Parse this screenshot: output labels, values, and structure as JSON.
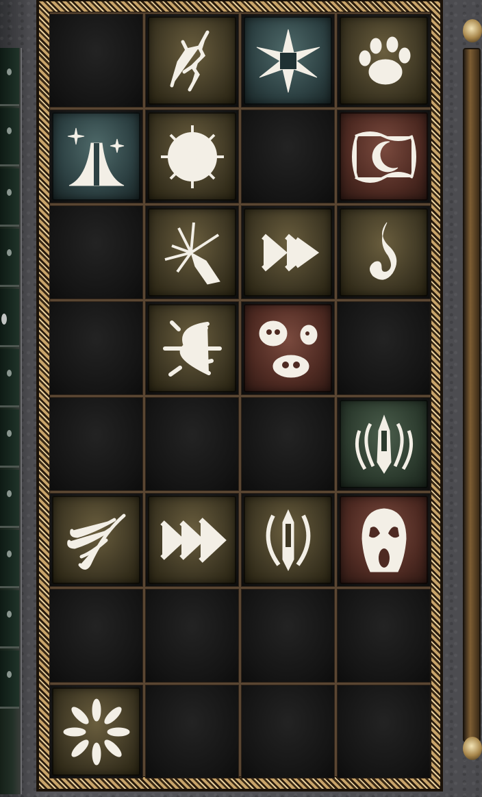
{
  "panel": {
    "columns": 4,
    "rows": 8,
    "slots": [
      {
        "filled": false
      },
      {
        "filled": true,
        "icon": "branch-crack-icon",
        "bg": "olive"
      },
      {
        "filled": true,
        "icon": "star-burst-icon",
        "bg": "teal"
      },
      {
        "filled": true,
        "icon": "paw-print-icon",
        "bg": "olive"
      },
      {
        "filled": true,
        "icon": "sparkle-mountain-icon",
        "bg": "teal"
      },
      {
        "filled": true,
        "icon": "spider-web-icon",
        "bg": "olive"
      },
      {
        "filled": false
      },
      {
        "filled": true,
        "icon": "crescent-moon-icon",
        "bg": "maroon"
      },
      {
        "filled": false
      },
      {
        "filled": true,
        "icon": "shatter-strike-icon",
        "bg": "olive"
      },
      {
        "filled": true,
        "icon": "double-chevron-icon",
        "bg": "olive"
      },
      {
        "filled": true,
        "icon": "wisp-flame-icon",
        "bg": "olive"
      },
      {
        "filled": false
      },
      {
        "filled": true,
        "icon": "thorn-rune-icon",
        "bg": "olive"
      },
      {
        "filled": true,
        "icon": "skull-cluster-icon",
        "bg": "maroon"
      },
      {
        "filled": false
      },
      {
        "filled": false
      },
      {
        "filled": false
      },
      {
        "filled": false
      },
      {
        "filled": true,
        "icon": "tribal-shield-icon",
        "bg": "green"
      },
      {
        "filled": true,
        "icon": "wind-gust-icon",
        "bg": "olive"
      },
      {
        "filled": true,
        "icon": "triple-chevron-icon",
        "bg": "olive"
      },
      {
        "filled": true,
        "icon": "tribal-blade-icon",
        "bg": "olive"
      },
      {
        "filled": true,
        "icon": "ghost-scream-icon",
        "bg": "maroon"
      },
      {
        "filled": false
      },
      {
        "filled": false
      },
      {
        "filled": false
      },
      {
        "filled": false
      },
      {
        "filled": true,
        "icon": "petal-burst-icon",
        "bg": "olive"
      },
      {
        "filled": false
      },
      {
        "filled": false
      },
      {
        "filled": false
      }
    ]
  },
  "colors": {
    "frame_gold": "#c8a46a",
    "slot_empty": "#141414",
    "icon_olive": "#4f4630",
    "icon_teal": "#33494b",
    "icon_maroon": "#5a3027",
    "icon_green": "#304032"
  }
}
